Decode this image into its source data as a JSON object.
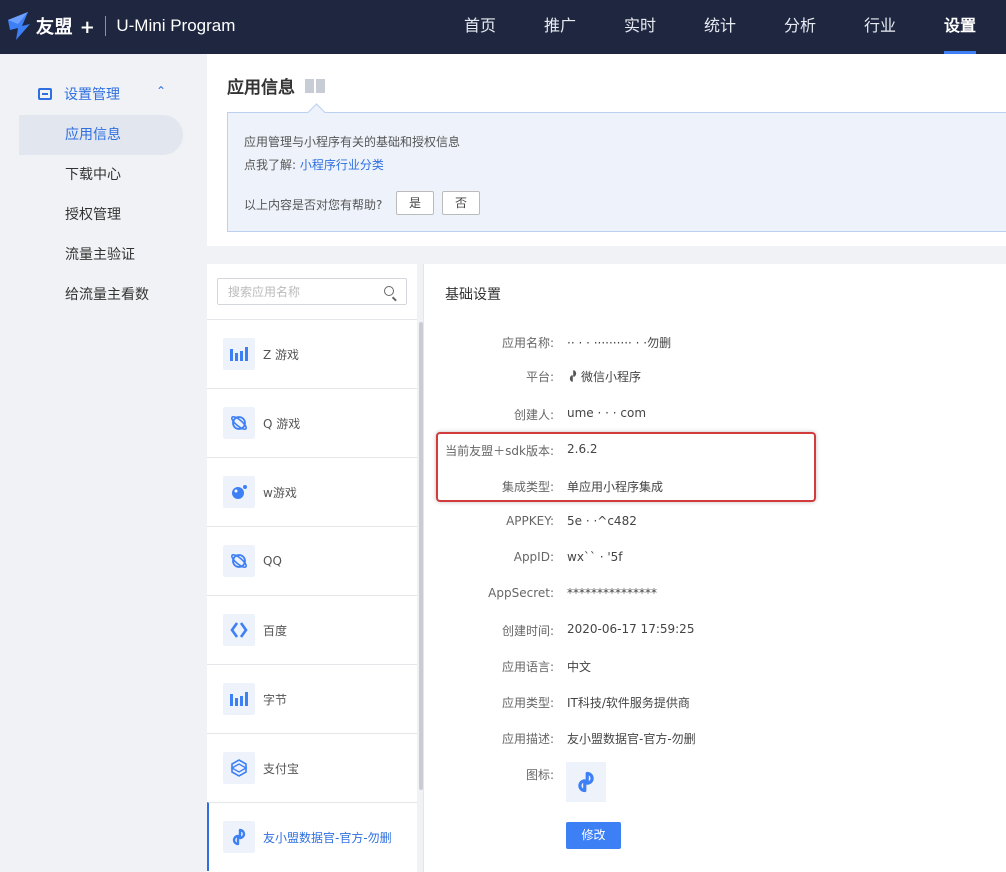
{
  "topbar": {
    "brand": "友盟 +",
    "product": "U-Mini Program",
    "nav": [
      "首页",
      "推广",
      "实时",
      "统计",
      "分析",
      "行业",
      "设置"
    ],
    "active_nav": "设置"
  },
  "sidebar": {
    "group_label": "设置管理",
    "items": [
      {
        "label": "应用信息",
        "active": true
      },
      {
        "label": "下载中心"
      },
      {
        "label": "授权管理"
      },
      {
        "label": "流量主验证"
      },
      {
        "label": "给流量主看数"
      }
    ]
  },
  "info": {
    "title": "应用信息",
    "line1": "应用管理与小程序有关的基础和授权信息",
    "line2_prefix": "点我了解:",
    "line2_link": "小程序行业分类",
    "question": "以上内容是否对您有帮助?",
    "yes": "是",
    "no": "否"
  },
  "applist": {
    "search_placeholder": "搜索应用名称",
    "items": [
      {
        "name": "Z 游戏",
        "icon": "bar-chart-icon"
      },
      {
        "name": "Q 游戏",
        "icon": "planet-icon"
      },
      {
        "name": "w游戏",
        "icon": "bubble-icon"
      },
      {
        "name": "QQ",
        "icon": "planet-icon"
      },
      {
        "name": "百度",
        "icon": "chevrons-icon"
      },
      {
        "name": "字节",
        "icon": "bar-chart-icon"
      },
      {
        "name": "支付宝",
        "icon": "cube-icon"
      },
      {
        "name": "友小盟数据官-官方-勿删",
        "icon": "link-icon",
        "active": true
      }
    ]
  },
  "detail": {
    "title": "基础设置",
    "rows": [
      {
        "label": "应用名称:",
        "value": "·· · · ··········  · ·勿删"
      },
      {
        "label": "平台:",
        "value": "微信小程序"
      },
      {
        "label": "创建人:",
        "value": "ume ·                              ·   ·   com"
      },
      {
        "label": "当前友盟＋sdk版本:",
        "value": "2.6.2"
      },
      {
        "label": "集成类型:",
        "value": "单应用小程序集成"
      },
      {
        "label": "APPKEY:",
        "value": "5e ·                          ·^c482"
      },
      {
        "label": "AppID:",
        "value": "wx`` ·                        '5f"
      },
      {
        "label": "AppSecret:",
        "value": "***************"
      },
      {
        "label": "创建时间:",
        "value": "2020-06-17 17:59:25"
      },
      {
        "label": "应用语言:",
        "value": "中文"
      },
      {
        "label": "应用类型:",
        "value": "IT科技/软件服务提供商"
      },
      {
        "label": "应用描述:",
        "value": "友小盟数据官-官方-勿删"
      },
      {
        "label": "图标:",
        "value": ""
      }
    ],
    "edit_button": "修改"
  }
}
